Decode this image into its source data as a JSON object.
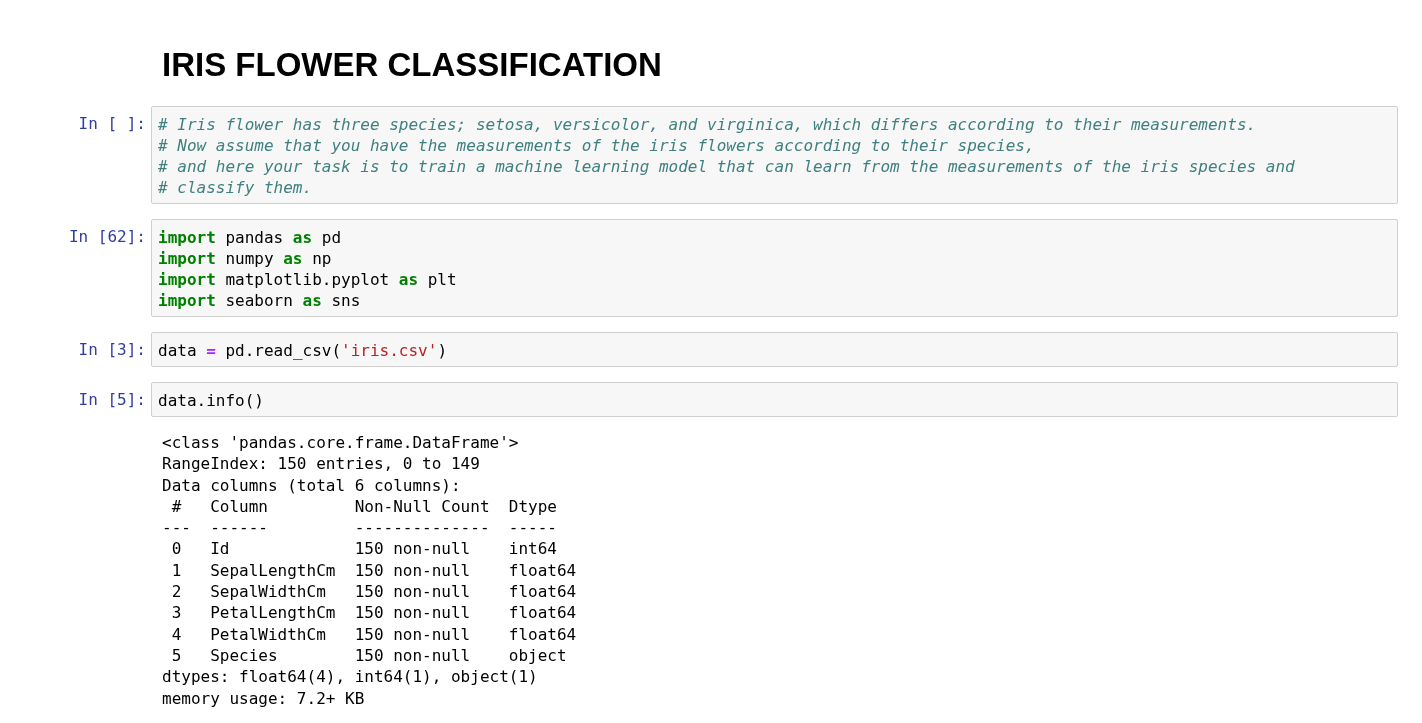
{
  "title": "IRIS FLOWER CLASSIFICATION",
  "cells": [
    {
      "prompt": "In [ ]:",
      "lines": [
        [
          {
            "kind": "comment",
            "text": "# Iris flower has three species; setosa, versicolor, and virginica, which differs according to their measurements."
          }
        ],
        [
          {
            "kind": "comment",
            "text": "# Now assume that you have the measurements of the iris flowers according to their species,"
          }
        ],
        [
          {
            "kind": "comment",
            "text": "# and here your task is to train a machine learning model that can learn from the measurements of the iris species and"
          }
        ],
        [
          {
            "kind": "comment",
            "text": "# classify them."
          }
        ]
      ]
    },
    {
      "prompt": "In [62]:",
      "lines": [
        [
          {
            "kind": "keyword",
            "text": "import"
          },
          {
            "kind": "text",
            "text": " pandas "
          },
          {
            "kind": "keyword",
            "text": "as"
          },
          {
            "kind": "text",
            "text": " pd"
          }
        ],
        [
          {
            "kind": "keyword",
            "text": "import"
          },
          {
            "kind": "text",
            "text": " numpy "
          },
          {
            "kind": "keyword",
            "text": "as"
          },
          {
            "kind": "text",
            "text": " np"
          }
        ],
        [
          {
            "kind": "keyword",
            "text": "import"
          },
          {
            "kind": "text",
            "text": " matplotlib.pyplot "
          },
          {
            "kind": "keyword",
            "text": "as"
          },
          {
            "kind": "text",
            "text": " plt"
          }
        ],
        [
          {
            "kind": "keyword",
            "text": "import"
          },
          {
            "kind": "text",
            "text": " seaborn "
          },
          {
            "kind": "keyword",
            "text": "as"
          },
          {
            "kind": "text",
            "text": " sns"
          }
        ]
      ]
    },
    {
      "prompt": "In [3]:",
      "lines": [
        [
          {
            "kind": "text",
            "text": "data "
          },
          {
            "kind": "operator",
            "text": "="
          },
          {
            "kind": "text",
            "text": " pd.read_csv("
          },
          {
            "kind": "string",
            "text": "'iris.csv'"
          },
          {
            "kind": "text",
            "text": ")"
          }
        ]
      ]
    },
    {
      "prompt": "In [5]:",
      "lines": [
        [
          {
            "kind": "text",
            "text": "data.info()"
          }
        ]
      ],
      "output": [
        "<class 'pandas.core.frame.DataFrame'>",
        "RangeIndex: 150 entries, 0 to 149",
        "Data columns (total 6 columns):",
        " #   Column         Non-Null Count  Dtype  ",
        "---  ------         --------------  -----  ",
        " 0   Id             150 non-null    int64  ",
        " 1   SepalLengthCm  150 non-null    float64",
        " 2   SepalWidthCm   150 non-null    float64",
        " 3   PetalLengthCm  150 non-null    float64",
        " 4   PetalWidthCm   150 non-null    float64",
        " 5   Species        150 non-null    object ",
        "dtypes: float64(4), int64(1), object(1)",
        "memory usage: 7.2+ KB"
      ]
    }
  ]
}
